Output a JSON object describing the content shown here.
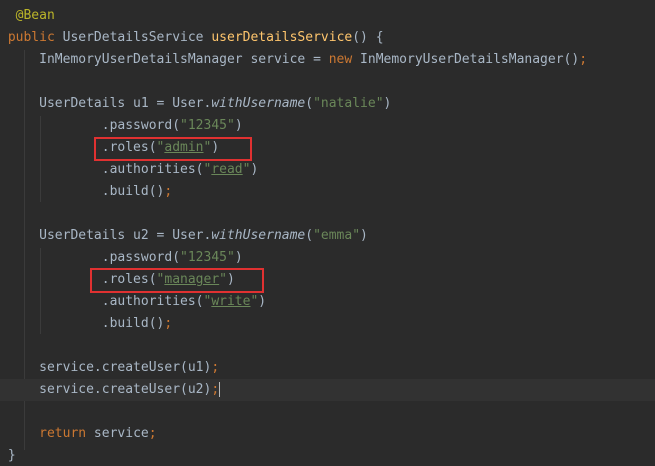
{
  "code": {
    "annotation": "@Bean",
    "kw_public": "public",
    "return_type": "UserDetailsService",
    "method_name": "userDetailsService",
    "method_tail": "() {",
    "line_manager": {
      "type": "InMemoryUserDetailsManager service = ",
      "kw_new": "new",
      "ctor": " InMemoryUserDetailsManager()",
      "semi": ";"
    },
    "user1": {
      "decl": "UserDetails u1 = User.",
      "with_username": "withUsername",
      "open": "(",
      "name": "\"natalie\"",
      "close": ")",
      "password_call": ".password(",
      "password": "\"12345\"",
      "roles_call": ".roles(",
      "role": "admin",
      "authorities_call": ".authorities(",
      "authority": "read",
      "build_call": ".build()",
      "semi": ";"
    },
    "user2": {
      "decl": "UserDetails u2 = User.",
      "with_username": "withUsername",
      "open": "(",
      "name": "\"emma\"",
      "close": ")",
      "password_call": ".password(",
      "password": "\"12345\"",
      "roles_call": ".roles(",
      "role": "manager",
      "authorities_call": ".authorities(",
      "authority": "write",
      "build_call": ".build()",
      "semi": ";"
    },
    "create_u1": "service.createUser(u1)",
    "create_u2": "service.createUser(u2)",
    "semi": ";",
    "kw_return": "return",
    "return_expr": " service",
    "closing_brace": "}",
    "quote": "\"",
    "paren_close": ")"
  },
  "colors": {
    "background": "#2b2b2b",
    "default_text": "#a9b7c6",
    "keyword": "#cc7832",
    "annotation": "#bbb529",
    "method_name": "#ffc66d",
    "string": "#6a8759",
    "highlight_box": "#e03131"
  }
}
